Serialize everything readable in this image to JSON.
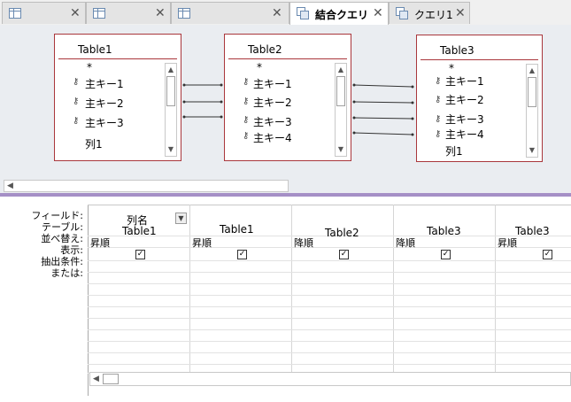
{
  "tabs": [
    {
      "label": "",
      "icon": "table-icon",
      "active": false
    },
    {
      "label": "",
      "icon": "table-icon",
      "active": false
    },
    {
      "label": "",
      "icon": "table-icon",
      "active": false
    },
    {
      "label": "結合クエリ",
      "icon": "query-icon",
      "active": true
    },
    {
      "label": "クエリ1",
      "icon": "query-icon",
      "active": false
    }
  ],
  "close_glyph": "✕",
  "tables": [
    {
      "name": "Table1",
      "fields": [
        "*",
        "主キー1",
        "主キー2",
        "主キー3",
        "列1"
      ]
    },
    {
      "name": "Table2",
      "fields": [
        "*",
        "主キー1",
        "主キー2",
        "主キー3",
        "主キー4"
      ]
    },
    {
      "name": "Table3",
      "fields": [
        "*",
        "主キー1",
        "主キー2",
        "主キー3",
        "主キー4",
        "列1"
      ]
    }
  ],
  "grid": {
    "row_labels": [
      "フィールド:",
      "テーブル:",
      "並べ替え:",
      "表示:",
      "抽出条件:",
      "または:"
    ],
    "columns": [
      {
        "field": "列名",
        "table": "Table1",
        "sort": "昇順",
        "show": true
      },
      {
        "field": "",
        "table": "Table1",
        "sort": "昇順",
        "show": true
      },
      {
        "field": "",
        "table": "Table2",
        "sort": "降順",
        "show": true
      },
      {
        "field": "",
        "table": "Table3",
        "sort": "降順",
        "show": true
      },
      {
        "field": "",
        "table": "Table3",
        "sort": "昇順",
        "show": true
      }
    ]
  },
  "colors": {
    "table_border": "#a9373c",
    "divider": "#a58fc6",
    "upper_bg": "#eaedf1"
  }
}
